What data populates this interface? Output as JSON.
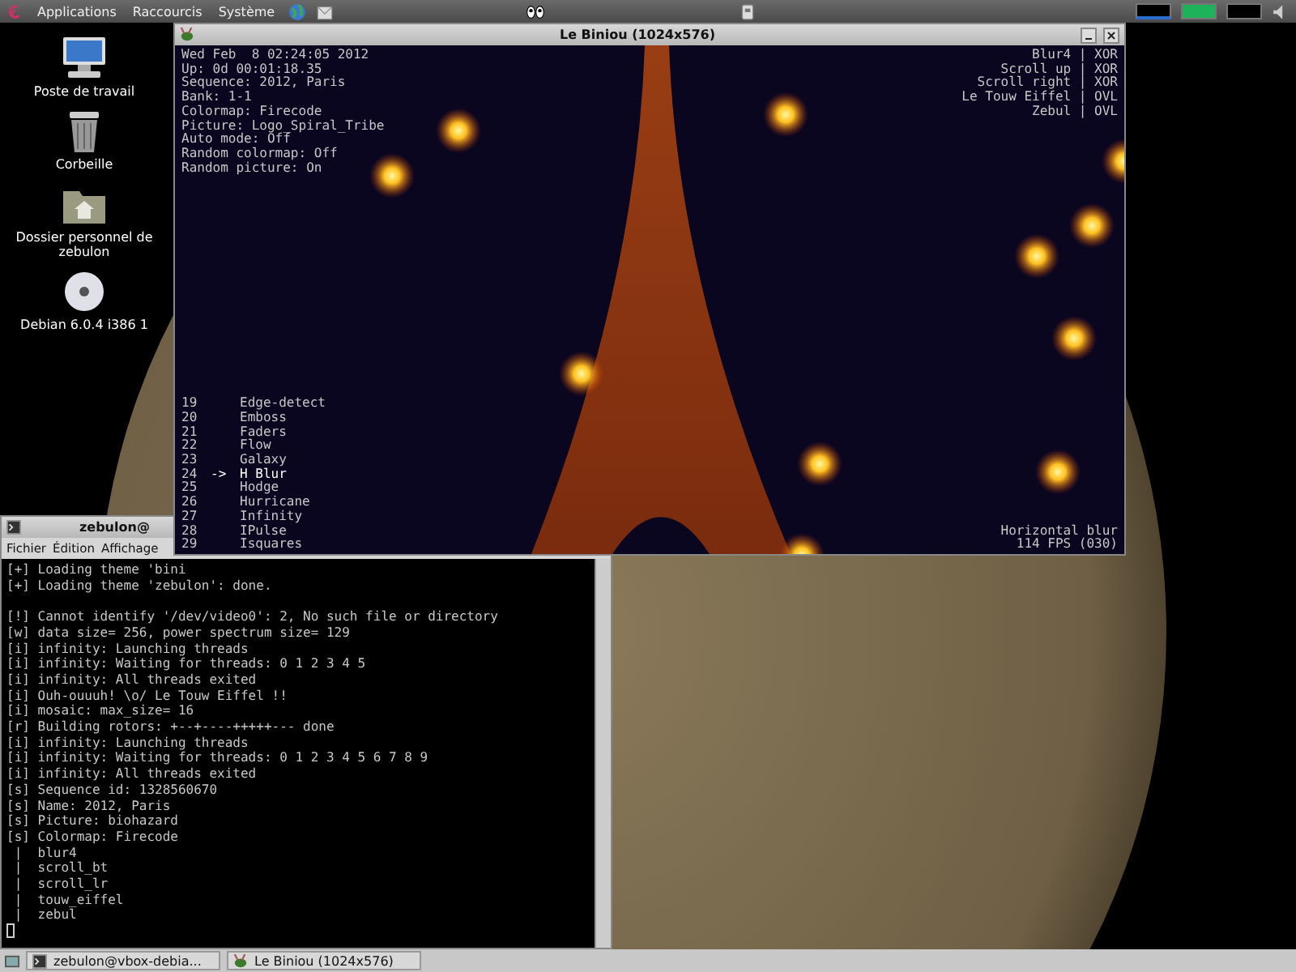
{
  "top_panel": {
    "menus": [
      "Applications",
      "Raccourcis",
      "Système"
    ]
  },
  "desktop_icons": [
    {
      "kind": "computer",
      "label": "Poste de travail"
    },
    {
      "kind": "trash",
      "label": "Corbeille"
    },
    {
      "kind": "home",
      "label": "Dossier personnel de zebulon"
    },
    {
      "kind": "disc",
      "label": "Debian 6.0.4 i386 1"
    }
  ],
  "biniou_window": {
    "title": "Le Biniou (1024x576)",
    "status": [
      "Wed Feb  8 02:24:05 2012",
      "Up: 0d 00:01:18.35",
      "Sequence: 2012, Paris",
      "Bank: 1-1",
      "Colormap: Firecode",
      "Picture: Logo_Spiral_Tribe",
      "Auto mode: Off",
      "Random colormap: Off",
      "Random picture: On"
    ],
    "layers": [
      "Blur4 | XOR",
      "Scroll up | XOR",
      "Scroll right | XOR",
      "Le Touw Eiffel | OVL",
      "Zebul | OVL"
    ],
    "plugins": {
      "pointer": "->",
      "items": [
        {
          "number": "19",
          "name": "Edge-detect",
          "selected": false
        },
        {
          "number": "20",
          "name": "Emboss",
          "selected": false
        },
        {
          "number": "21",
          "name": "Faders",
          "selected": false
        },
        {
          "number": "22",
          "name": "Flow",
          "selected": false
        },
        {
          "number": "23",
          "name": "Galaxy",
          "selected": false
        },
        {
          "number": "24",
          "name": "H Blur",
          "selected": true
        },
        {
          "number": "25",
          "name": "Hodge",
          "selected": false
        },
        {
          "number": "26",
          "name": "Hurricane",
          "selected": false
        },
        {
          "number": "27",
          "name": "Infinity",
          "selected": false
        },
        {
          "number": "28",
          "name": "IPulse",
          "selected": false
        },
        {
          "number": "29",
          "name": "Isquares",
          "selected": false
        }
      ]
    },
    "footer": [
      "Horizontal blur",
      "114 FPS (030)"
    ]
  },
  "terminal": {
    "title": "zebulon@",
    "menus": [
      "Fichier",
      "Édition",
      "Affichage"
    ],
    "groups": [
      [
        "[+] Loading theme 'bini",
        "[+] Loading theme 'zebulon': done."
      ],
      [
        "[!] Cannot identify '/dev/video0': 2, No such file or directory",
        "[w] data size= 256, power spectrum size= 129",
        "[i] infinity: Launching threads",
        "[i] infinity: Waiting for threads: 0 1 2 3 4 5",
        "[i] infinity: All threads exited",
        "[i] Ouh-ouuuh! \\o/ Le Touw Eiffel !!",
        "[i] mosaic: max_size= 16",
        "[r] Building rotors: +--+----+++++--- done",
        "[i] infinity: Launching threads",
        "[i] infinity: Waiting for threads: 0 1 2 3 4 5 6 7 8 9",
        "[i] infinity: All threads exited",
        "[s] Sequence id: 1328560670",
        "[s] Name: 2012, Paris",
        "[s] Picture: biohazard",
        "[s] Colormap: Firecode",
        " |  blur4",
        " |  scroll_bt",
        " |  scroll_lr",
        " |  touw_eiffel",
        " |  zebul"
      ]
    ]
  },
  "taskbar": {
    "tasks": [
      {
        "kind": "terminal",
        "label": "zebulon@vbox-debia..."
      },
      {
        "kind": "biniou",
        "label": "Le Biniou (1024x576)"
      }
    ]
  }
}
